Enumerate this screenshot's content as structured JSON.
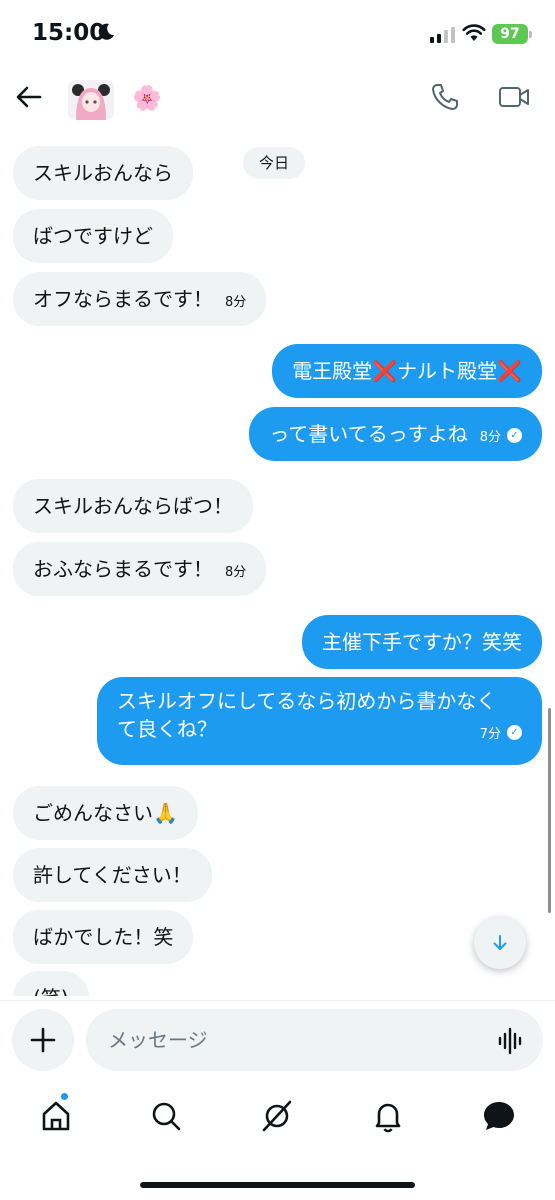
{
  "status_bar": {
    "time": "15:00",
    "battery": "97"
  },
  "chat": {
    "date_label": "今日",
    "messages": [
      {
        "text": "スキルおんなら",
        "time": ""
      },
      {
        "text": "ばつですけど",
        "time": ""
      },
      {
        "text": "オフならまるです！",
        "time": "8分"
      },
      {
        "text": "電王殿堂❌ナルト殿堂❌",
        "time": ""
      },
      {
        "text": "って書いてるっすよね",
        "time": "8分"
      },
      {
        "text": "スキルおんならばつ！",
        "time": ""
      },
      {
        "text": "おふならまるです！",
        "time": "8分"
      },
      {
        "text": "主催下手ですか？笑笑",
        "time": ""
      },
      {
        "text_line1": "スキルオフにしてるなら初めから書かなく",
        "text_line2": "て良くね？",
        "time": "7分"
      },
      {
        "text": "ごめんなさい🙏",
        "time": ""
      },
      {
        "text": "許してください！",
        "time": ""
      },
      {
        "text": "ばかでした！笑",
        "time": ""
      },
      {
        "text": "(笑)",
        "time": ""
      }
    ]
  },
  "composer": {
    "placeholder": "メッセージ"
  },
  "icons": {
    "back": "arrow-left-icon",
    "call": "phone-icon",
    "video": "video-camera-icon",
    "scroll": "arrow-down-icon",
    "plus": "plus-icon",
    "voice": "voice-wave-icon",
    "home": "home-icon",
    "search": "search-icon",
    "grok": "grok-icon",
    "notifications": "bell-icon",
    "messages": "message-bubble-icon"
  },
  "colors": {
    "accent": "#1d9bf0",
    "incoming_bubble": "#eff3f4",
    "battery": "#5cc953"
  }
}
